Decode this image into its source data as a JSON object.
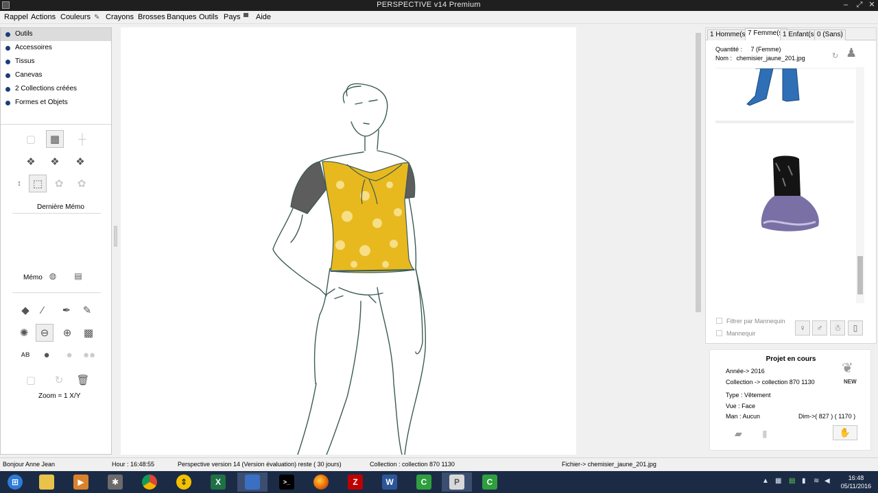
{
  "window": {
    "title": "PERSPECTIVE v14 Premium",
    "minimize": "–",
    "maximize": "⤢",
    "close": "✕"
  },
  "menu": [
    "Rappel",
    "Actions",
    "Couleurs",
    "Crayons",
    "Brosses",
    "Banques",
    "Outils",
    "Pays",
    "Aide"
  ],
  "nav": {
    "items": [
      "Outils",
      "Accessoires",
      "Tissus",
      "Canevas",
      "2 Collections créées",
      "Formes et Objets"
    ],
    "selected_index": 0
  },
  "tools": {
    "derniere_memo": "Dernière Mémo",
    "memo": "Mémo",
    "zoom": "Zoom = 1 X/Y"
  },
  "right": {
    "tabs": [
      "1 Homme(s)",
      "7 Femme(s)",
      "1 Enfant(s)",
      "0 (Sans)"
    ],
    "selected_tab": 1,
    "quantite_label": "Quantité :",
    "quantite_value": "7  (Femme)",
    "nom_label": "Nom :",
    "nom_value": "chemisier_jaune_201.jpg",
    "filters": [
      "Filtrer par Mannequin",
      "Mannequir"
    ]
  },
  "projet": {
    "title": "Projet en cours",
    "annee": "Année-> 2016",
    "collection": "Collection -> collection 870 1130",
    "type": "Type : Vêtement",
    "vue": "Vue :  Face",
    "man": "Man :  Aucun",
    "dim": "Dim->( 827 ) ( 1170 )",
    "new_badge": "NEW"
  },
  "status": {
    "greeting": "Bonjour Anne Jean",
    "hour": "Hour : 16:48:55",
    "version": "Perspective version 14 (Version évaluation) reste ( 30 jours)",
    "collection": "Collection : collection 870 1130",
    "file": "Fichier-> chemisier_jaune_201.jpg"
  },
  "taskbar": {
    "time": "16:48",
    "date": "05/11/2016",
    "apps": [
      {
        "name": "windows-start",
        "label": ""
      },
      {
        "name": "file-explorer",
        "label": ""
      },
      {
        "name": "media-player",
        "label": "▶"
      },
      {
        "name": "tool-app",
        "label": "✱"
      },
      {
        "name": "chrome",
        "label": ""
      },
      {
        "name": "norton",
        "label": "⇕"
      },
      {
        "name": "excel",
        "label": "X"
      },
      {
        "name": "paint-app",
        "label": ""
      },
      {
        "name": "terminal",
        "label": ">_"
      },
      {
        "name": "firefox",
        "label": ""
      },
      {
        "name": "filezilla",
        "label": "Z"
      },
      {
        "name": "word",
        "label": "W"
      },
      {
        "name": "camtasia-1",
        "label": "C"
      },
      {
        "name": "perspective",
        "label": "P"
      },
      {
        "name": "camtasia-2",
        "label": "C"
      }
    ]
  },
  "colors": {
    "accent": "#1d3d78",
    "yellow": "#e8b91e",
    "denim": "#2f6fb5"
  }
}
